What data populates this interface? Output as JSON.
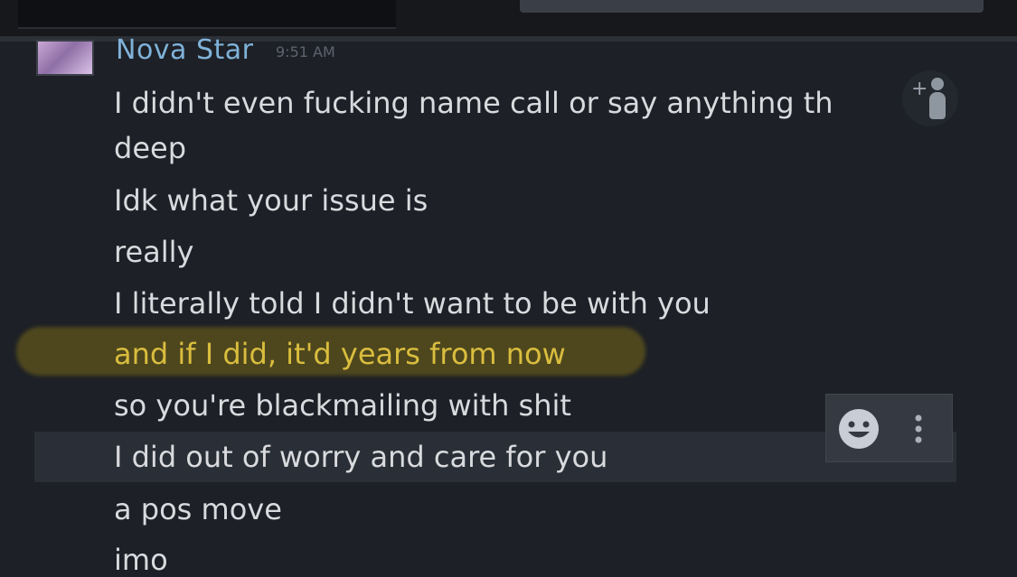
{
  "message": {
    "username": "Nova Star",
    "timestamp": "9:51 AM",
    "lines": [
      "I didn't even fucking name call or say anything th",
      "deep",
      "Idk what your issue is",
      "really",
      "I literally told I didn't want to be with you",
      "and if I did, it'd years from now",
      "so you're blackmailing with shit",
      "I did out of worry and care for you",
      "a pos move",
      "imo"
    ],
    "highlighted_line_index": 5
  },
  "colors": {
    "username": "#7fb2d9",
    "highlight_text": "#d9bd3e",
    "background": "#1d2026"
  },
  "icons": {
    "add_friend": "add-friend-icon",
    "emoji": "emoji-icon",
    "more": "more-options-icon"
  }
}
